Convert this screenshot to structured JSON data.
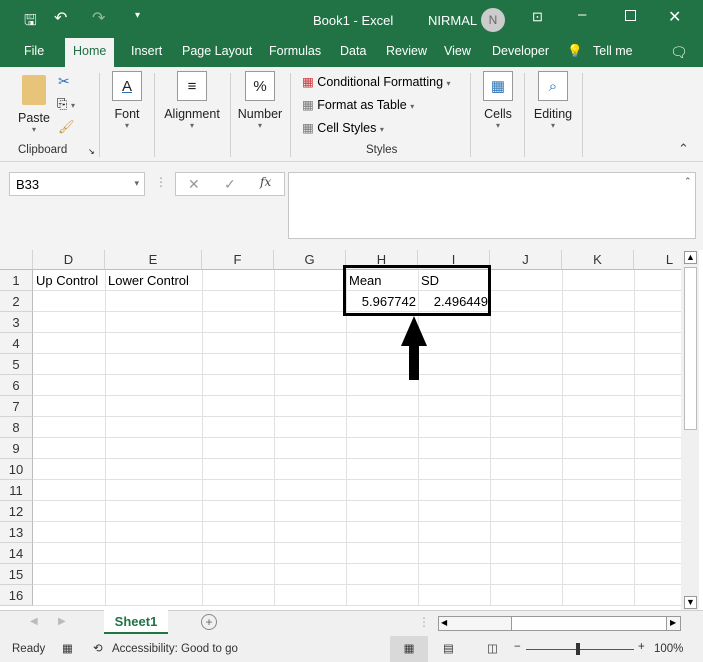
{
  "title": {
    "doc": "Book1",
    "app": "Excel",
    "separator": "-",
    "user": "NIRMAL",
    "avatar": "N"
  },
  "tabs": [
    "File",
    "Home",
    "Insert",
    "Page Layout",
    "Formulas",
    "Data",
    "Review",
    "View",
    "Developer",
    "Tell me"
  ],
  "ribbon": {
    "paste": "Paste",
    "font": "Font",
    "alignment": "Alignment",
    "number": "Number",
    "cond": "Conditional Formatting",
    "table": "Format as Table",
    "styles": "Cell Styles",
    "cells": "Cells",
    "editing": "Editing",
    "clipboard_group": "Clipboard",
    "styles_group": "Styles"
  },
  "formula_bar": {
    "name_box": "B33",
    "formula": ""
  },
  "columns": [
    "D",
    "E",
    "F",
    "G",
    "H",
    "I",
    "J",
    "K",
    "L"
  ],
  "rows": [
    "1",
    "2",
    "3",
    "4",
    "5",
    "6",
    "7",
    "8",
    "9",
    "10",
    "11",
    "12",
    "13",
    "14",
    "15",
    "16"
  ],
  "cells": {
    "D1": "Up Control",
    "E1": "Lower Control",
    "H1": "Mean",
    "I1": "SD",
    "H2": "5.967742",
    "I2": "2.496449"
  },
  "sheets": [
    "Sheet1"
  ],
  "status": {
    "ready": "Ready",
    "accessibility": "Accessibility: Good to go",
    "zoom": "100%"
  }
}
